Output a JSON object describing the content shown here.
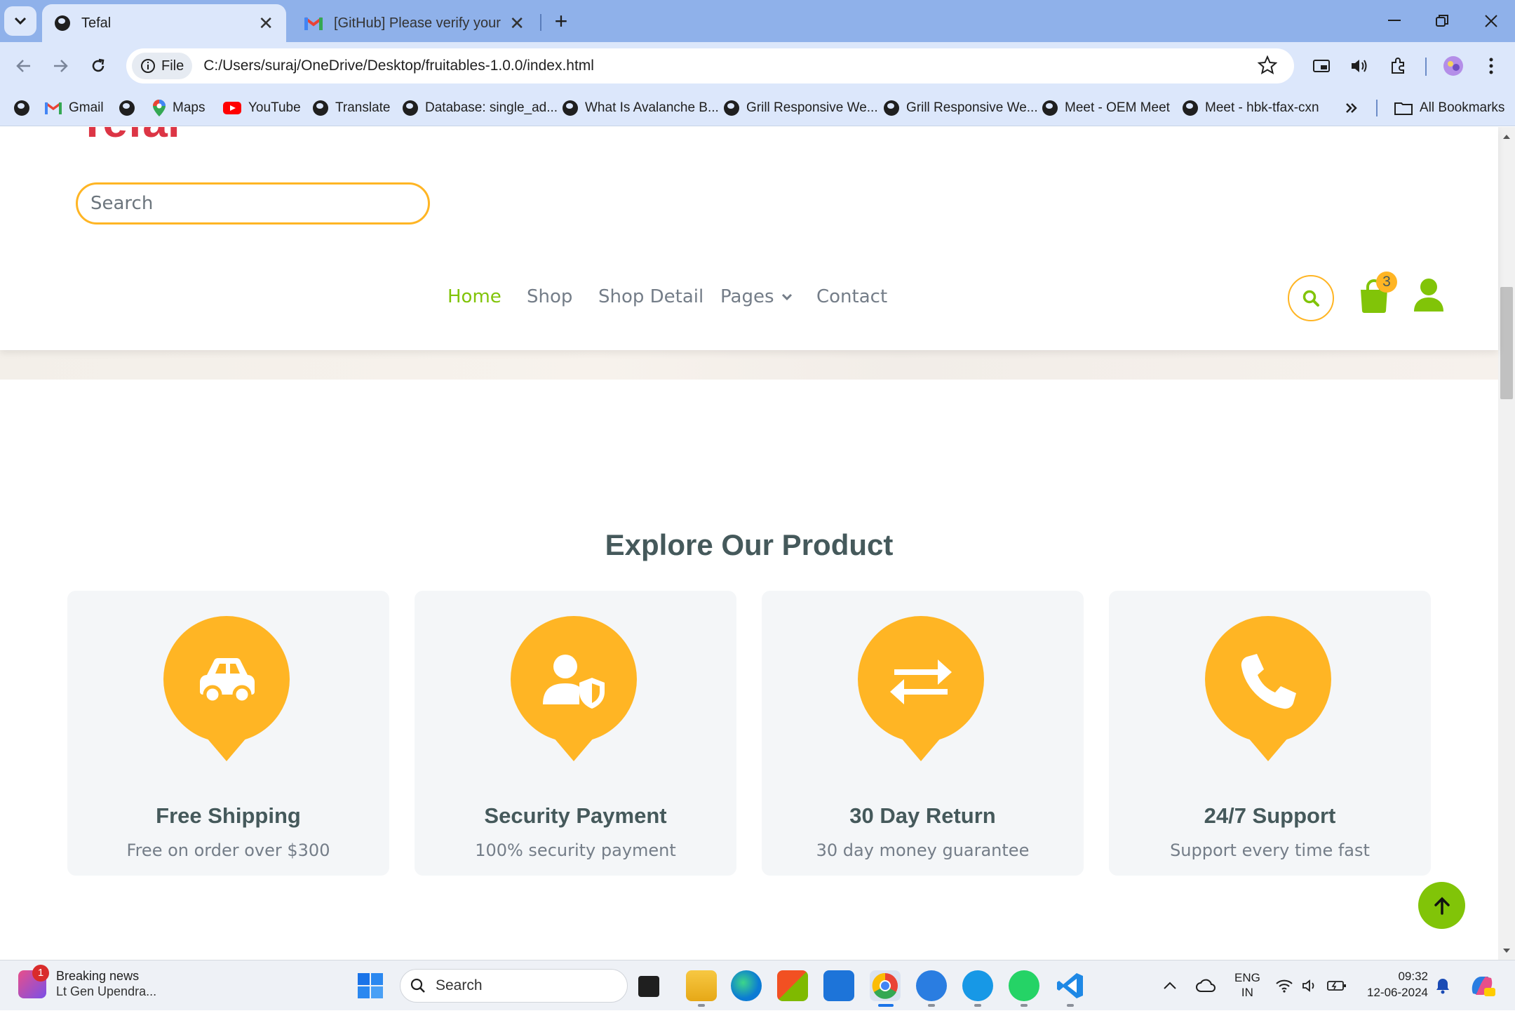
{
  "browser": {
    "tabs": [
      {
        "title": "Tefal",
        "active": true
      },
      {
        "title": "[GitHub] Please verify your devi",
        "active": false
      }
    ],
    "file_label": "File",
    "url": "C:/Users/suraj/OneDrive/Desktop/fruitables-1.0.0/index.html",
    "bookmarks": [
      {
        "label": ""
      },
      {
        "label": "Gmail"
      },
      {
        "label": ""
      },
      {
        "label": "Maps"
      },
      {
        "label": "YouTube"
      },
      {
        "label": "Translate"
      },
      {
        "label": "Database: single_ad..."
      },
      {
        "label": "What Is Avalanche B..."
      },
      {
        "label": "Grill Responsive We..."
      },
      {
        "label": "Grill Responsive We..."
      },
      {
        "label": "Meet - OEM Meet"
      },
      {
        "label": "Meet - hbk-tfax-cxn"
      }
    ],
    "all_bookmarks": "All Bookmarks"
  },
  "page": {
    "logo_partial": "Tefal",
    "search_placeholder": "Search",
    "nav": {
      "home": "Home",
      "shop": "Shop",
      "shop_detail": "Shop Detail",
      "pages": "Pages",
      "contact": "Contact"
    },
    "cart_count": "3",
    "section_title": "Explore Our Product",
    "features": [
      {
        "icon": "car-icon",
        "title": "Free Shipping",
        "subtitle": "Free on order over $300"
      },
      {
        "icon": "user-shield-icon",
        "title": "Security Payment",
        "subtitle": "100% security payment"
      },
      {
        "icon": "exchange-arrows-icon",
        "title": "30 Day Return",
        "subtitle": "30 day money guarantee"
      },
      {
        "icon": "phone-icon",
        "title": "24/7 Support",
        "subtitle": "Support every time fast"
      }
    ],
    "colors": {
      "primary": "#81c408",
      "secondary": "#ffb524",
      "heading": "#45595b",
      "text": "#747d88"
    }
  },
  "taskbar": {
    "news_badge": "1",
    "news_title": "Breaking news",
    "news_sub": "Lt Gen Upendra...",
    "search_label": "Search",
    "lang_top": "ENG",
    "lang_bottom": "IN",
    "time": "09:32",
    "date": "12-06-2024"
  }
}
